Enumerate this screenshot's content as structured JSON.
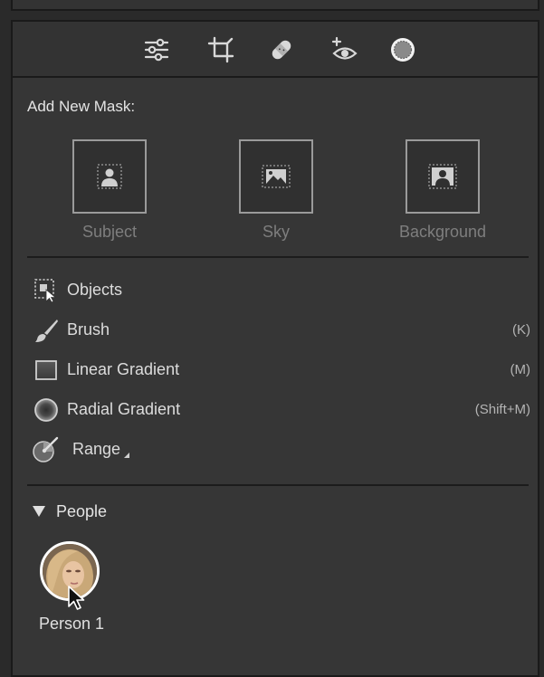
{
  "toolbar": {
    "tools": [
      {
        "icon": "sliders-icon"
      },
      {
        "icon": "crop-icon"
      },
      {
        "icon": "healing-bandage-icon"
      },
      {
        "icon": "red-eye-icon"
      },
      {
        "icon": "masking-icon",
        "active": true
      }
    ]
  },
  "add_mask": {
    "label": "Add New Mask:",
    "types": [
      {
        "label": "Subject",
        "icon": "subject-mask-icon"
      },
      {
        "label": "Sky",
        "icon": "sky-mask-icon"
      },
      {
        "label": "Background",
        "icon": "background-mask-icon"
      }
    ]
  },
  "mask_tools": [
    {
      "label": "Objects",
      "shortcut": "",
      "icon": "objects-icon"
    },
    {
      "label": "Brush",
      "shortcut": "(K)",
      "icon": "brush-icon"
    },
    {
      "label": "Linear Gradient",
      "shortcut": "(M)",
      "icon": "linear-gradient-icon"
    },
    {
      "label": "Radial Gradient",
      "shortcut": "(Shift+M)",
      "icon": "radial-gradient-icon"
    },
    {
      "label": "Range",
      "shortcut": "",
      "icon": "range-icon"
    }
  ],
  "people": {
    "label": "People",
    "expanded": true,
    "persons": [
      {
        "name": "Person 1"
      }
    ]
  },
  "colors": {
    "panel_bg": "#363636",
    "border": "#1a1a1a",
    "text": "#e4e4e4",
    "disabled_text": "#7e7e7e"
  }
}
